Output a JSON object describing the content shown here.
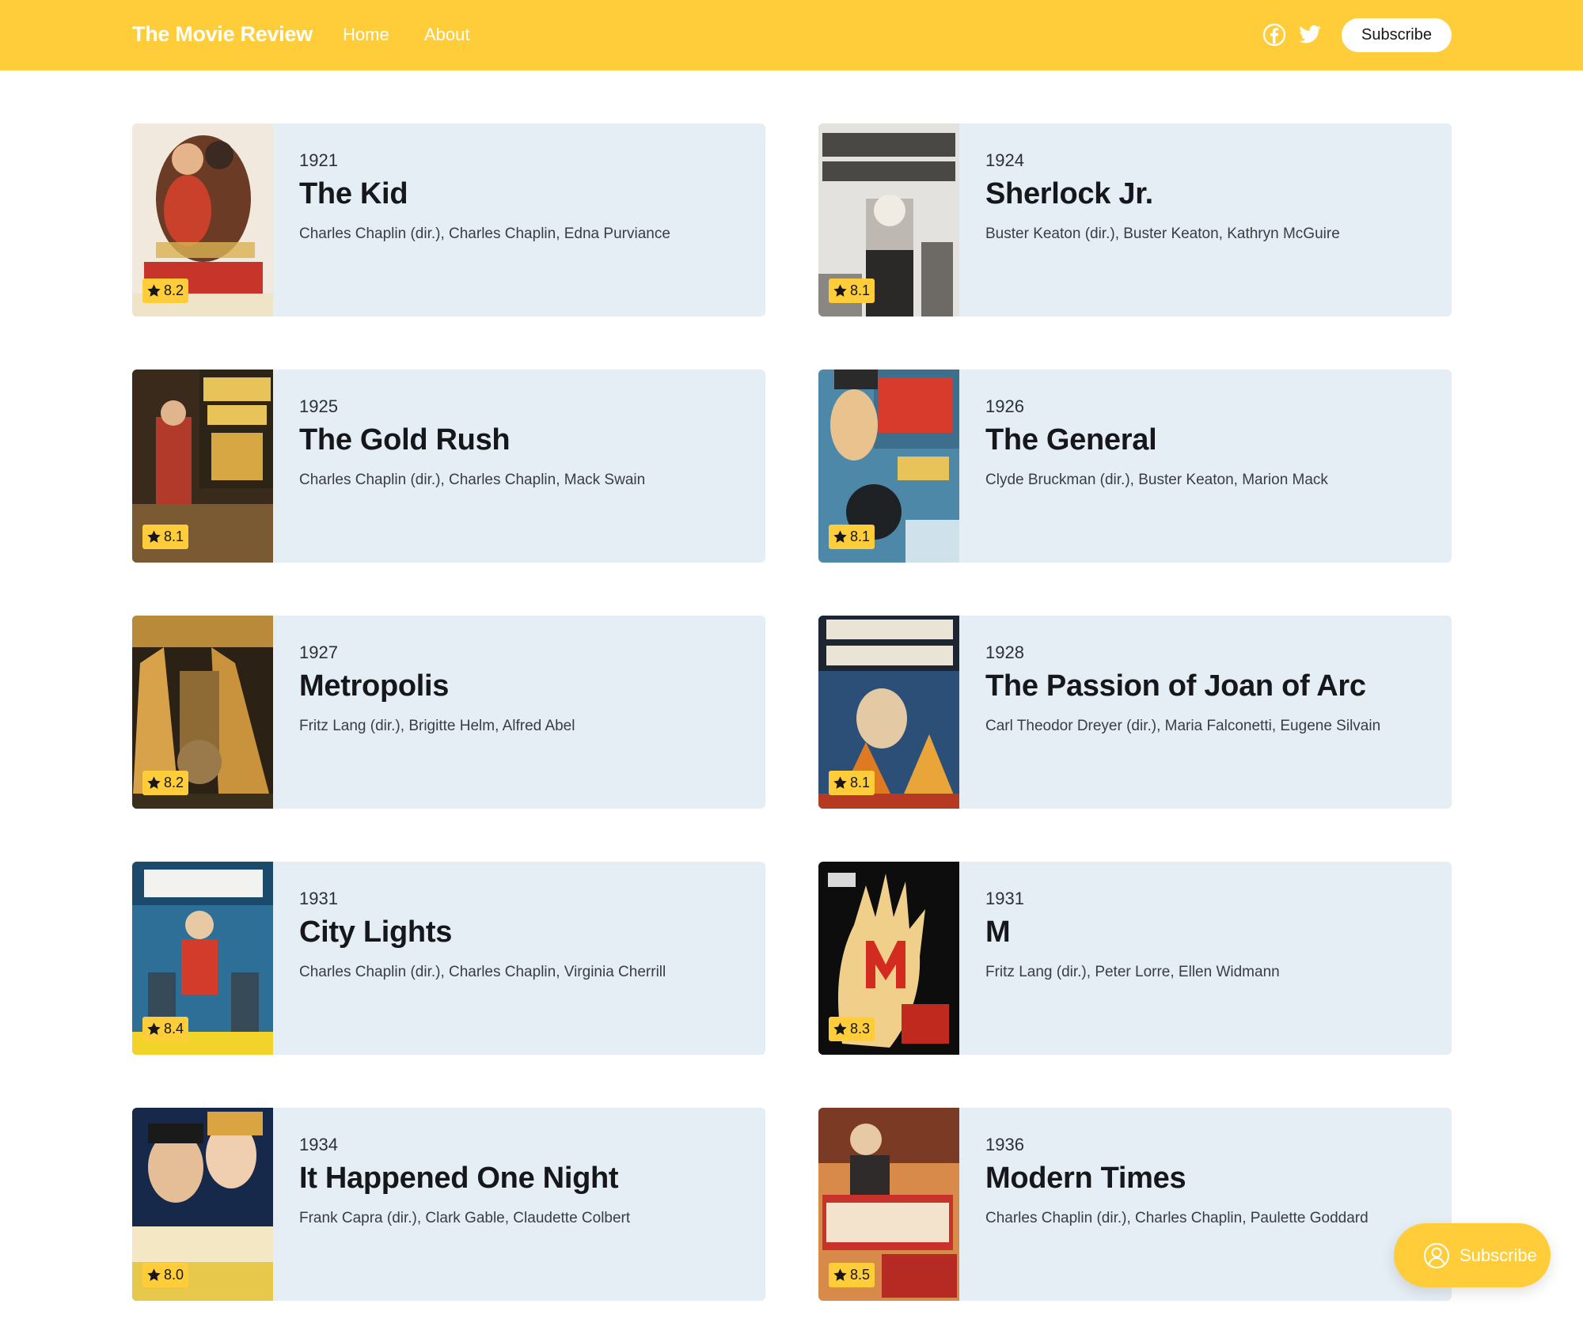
{
  "header": {
    "brand": "The Movie Review",
    "nav": [
      {
        "label": "Home"
      },
      {
        "label": "About"
      }
    ],
    "social": [
      {
        "icon": "facebook-icon"
      },
      {
        "icon": "twitter-icon"
      }
    ],
    "subscribe_label": "Subscribe"
  },
  "theme": {
    "accent": "#ffcd39",
    "card_bg": "#e5edf5",
    "text": "#15171a"
  },
  "movies": [
    {
      "year": "1921",
      "title": "The Kid",
      "credits": "Charles Chaplin (dir.), Charles Chaplin, Edna Purviance",
      "rating": "8.2"
    },
    {
      "year": "1924",
      "title": "Sherlock Jr.",
      "credits": "Buster Keaton (dir.), Buster Keaton, Kathryn McGuire",
      "rating": "8.1"
    },
    {
      "year": "1925",
      "title": "The Gold Rush",
      "credits": "Charles Chaplin (dir.), Charles Chaplin, Mack Swain",
      "rating": "8.1"
    },
    {
      "year": "1926",
      "title": "The General",
      "credits": "Clyde Bruckman (dir.), Buster Keaton, Marion Mack",
      "rating": "8.1"
    },
    {
      "year": "1927",
      "title": "Metropolis",
      "credits": "Fritz Lang (dir.), Brigitte Helm, Alfred Abel",
      "rating": "8.2"
    },
    {
      "year": "1928",
      "title": "The Passion of Joan of Arc",
      "credits": "Carl Theodor Dreyer (dir.), Maria Falconetti, Eugene Silvain",
      "rating": "8.1"
    },
    {
      "year": "1931",
      "title": "City Lights",
      "credits": "Charles Chaplin (dir.), Charles Chaplin, Virginia Cherrill",
      "rating": "8.4"
    },
    {
      "year": "1931",
      "title": "M",
      "credits": "Fritz Lang (dir.), Peter Lorre, Ellen Widmann",
      "rating": "8.3"
    },
    {
      "year": "1934",
      "title": "It Happened One Night",
      "credits": "Frank Capra (dir.), Clark Gable, Claudette Colbert",
      "rating": "8.0"
    },
    {
      "year": "1936",
      "title": "Modern Times",
      "credits": "Charles Chaplin (dir.), Charles Chaplin, Paulette Goddard",
      "rating": "8.5"
    }
  ],
  "floating_subscribe": {
    "label": "Subscribe",
    "icon": "user-icon"
  }
}
